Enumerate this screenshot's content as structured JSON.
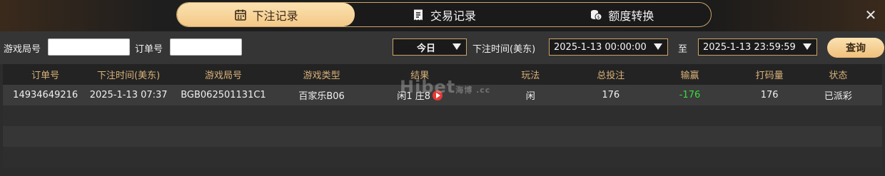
{
  "tabs": [
    {
      "label": "下注记录",
      "icon": "calendar-icon",
      "active": true
    },
    {
      "label": "交易记录",
      "icon": "receipt-icon",
      "active": false
    },
    {
      "label": "额度转换",
      "icon": "coins-icon",
      "active": false
    }
  ],
  "close_icon": "close-icon",
  "filters": {
    "game_round_label": "游戏局号",
    "game_round_value": "",
    "order_label": "订单号",
    "order_value": "",
    "period_value": "今日",
    "time_label": "下注时间(美东)",
    "start_time": "2025-1-13 00:00:00",
    "to_label": "至",
    "end_time": "2025-1-13 23:59:59",
    "query_label": "查询"
  },
  "table": {
    "headers": [
      "订单号",
      "下注时间(美东)",
      "游戏局号",
      "游戏类型",
      "结果",
      "玩法",
      "总投注",
      "输赢",
      "打码量",
      "状态"
    ],
    "rows": [
      [
        "14934649216",
        "2025-1-13 07:37",
        "BGB062501131C1",
        "百家乐B06",
        "闲1 庄8",
        "闲",
        "176",
        "-176",
        "176",
        "已派彩"
      ]
    ]
  },
  "watermark": {
    "main": "Hibet",
    "sub": "海博 .cc"
  },
  "colors": {
    "accent": "#f3c887",
    "header_text": "#d9b27a",
    "loss": "#3ddc3d",
    "play_icon": "#e53935"
  }
}
